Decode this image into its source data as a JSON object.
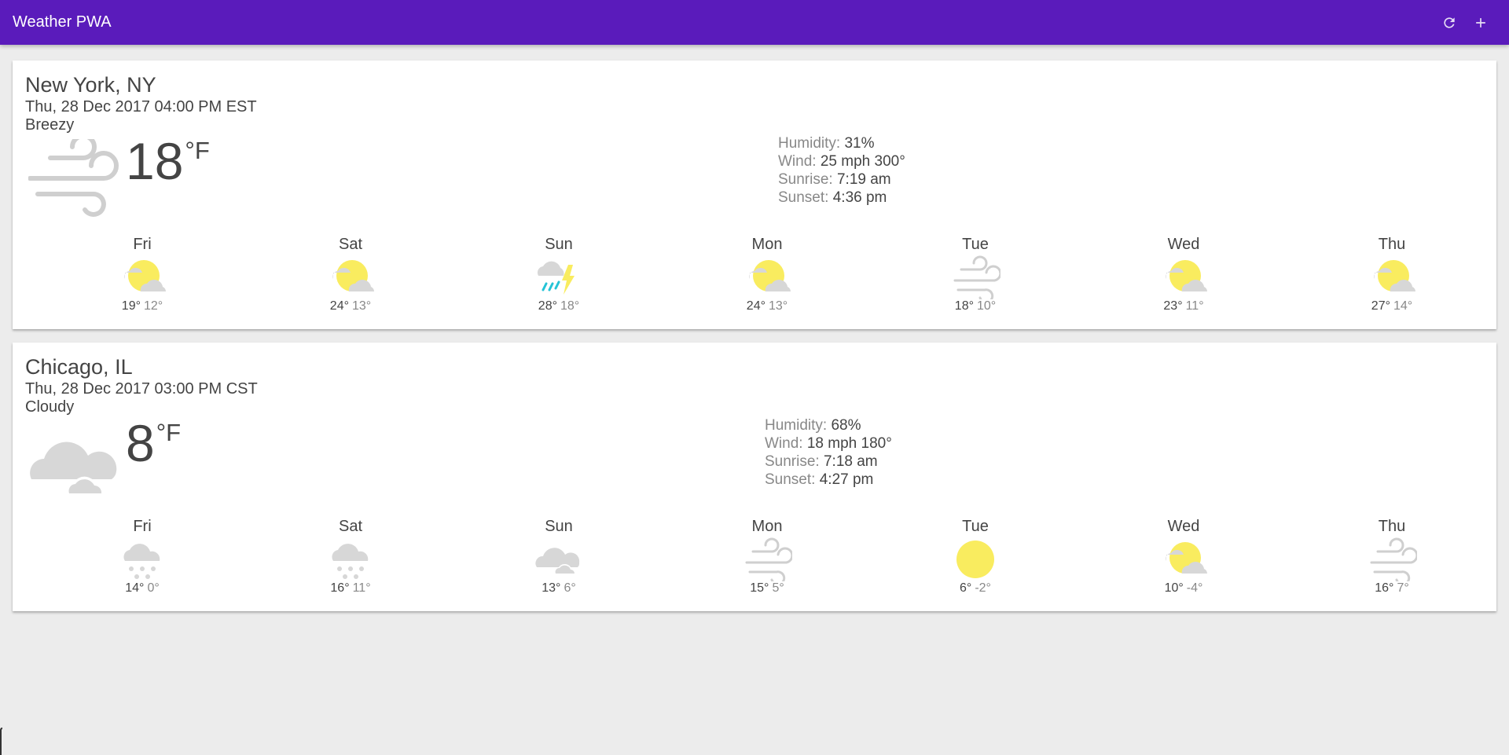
{
  "header": {
    "title": "Weather PWA",
    "refresh_icon": "refresh-icon",
    "add_icon": "add-icon",
    "color": "#5a1bbb"
  },
  "cards": [
    {
      "city": "New York, NY",
      "date": "Thu, 28 Dec 2017 04:00 PM EST",
      "description": "Breezy",
      "current_icon": "wind-icon",
      "temperature": "18",
      "unit": "°F",
      "humidity_label": "Humidity:",
      "humidity": "31%",
      "wind_label": "Wind:",
      "wind": "25 mph 300°",
      "sunrise_label": "Sunrise:",
      "sunrise": "7:19 am",
      "sunset_label": "Sunset:",
      "sunset": "4:36 pm",
      "forecast": [
        {
          "day": "Fri",
          "icon": "partly-cloudy-icon",
          "high": "19°",
          "low": "12°"
        },
        {
          "day": "Sat",
          "icon": "partly-cloudy-icon",
          "high": "24°",
          "low": "13°"
        },
        {
          "day": "Sun",
          "icon": "thunderstorm-icon",
          "high": "28°",
          "low": "18°"
        },
        {
          "day": "Mon",
          "icon": "partly-cloudy-icon",
          "high": "24°",
          "low": "13°"
        },
        {
          "day": "Tue",
          "icon": "wind-icon",
          "high": "18°",
          "low": "10°"
        },
        {
          "day": "Wed",
          "icon": "partly-cloudy-icon",
          "high": "23°",
          "low": "11°"
        },
        {
          "day": "Thu",
          "icon": "partly-cloudy-icon",
          "high": "27°",
          "low": "14°"
        }
      ]
    },
    {
      "city": "Chicago, IL",
      "date": "Thu, 28 Dec 2017 03:00 PM CST",
      "description": "Cloudy",
      "current_icon": "cloudy-icon",
      "temperature": "8",
      "unit": "°F",
      "humidity_label": "Humidity:",
      "humidity": "68%",
      "wind_label": "Wind:",
      "wind": "18 mph 180°",
      "sunrise_label": "Sunrise:",
      "sunrise": "7:18 am",
      "sunset_label": "Sunset:",
      "sunset": "4:27 pm",
      "forecast": [
        {
          "day": "Fri",
          "icon": "snow-icon",
          "high": "14°",
          "low": "0°"
        },
        {
          "day": "Sat",
          "icon": "snow-icon",
          "high": "16°",
          "low": "11°"
        },
        {
          "day": "Sun",
          "icon": "cloudy-icon",
          "high": "13°",
          "low": "6°"
        },
        {
          "day": "Mon",
          "icon": "wind-icon",
          "high": "15°",
          "low": "5°"
        },
        {
          "day": "Tue",
          "icon": "clear-day-icon",
          "high": "6°",
          "low": "-2°"
        },
        {
          "day": "Wed",
          "icon": "partly-cloudy-icon",
          "high": "10°",
          "low": "-4°"
        },
        {
          "day": "Thu",
          "icon": "wind-icon",
          "high": "16°",
          "low": "7°"
        }
      ]
    }
  ]
}
